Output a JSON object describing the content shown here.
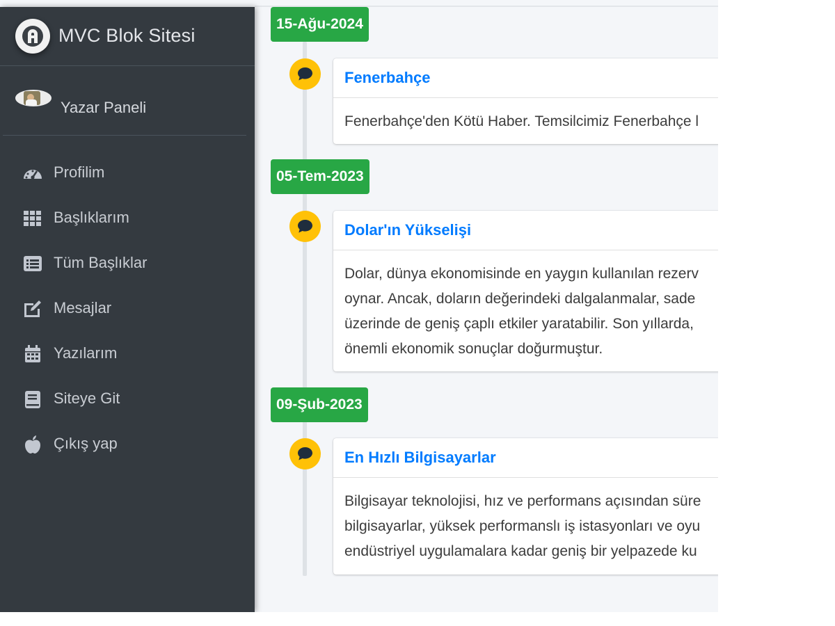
{
  "sidebar": {
    "brand": "MVC Blok Sitesi",
    "user": "Yazar Paneli",
    "items": [
      {
        "label": "Profilim",
        "icon": "tachometer-icon"
      },
      {
        "label": "Başlıklarım",
        "icon": "grid-icon"
      },
      {
        "label": "Tüm Başlıklar",
        "icon": "list-icon"
      },
      {
        "label": "Mesajlar",
        "icon": "edit-icon"
      },
      {
        "label": "Yazılarım",
        "icon": "calendar-icon"
      },
      {
        "label": "Siteye Git",
        "icon": "book-icon"
      },
      {
        "label": "Çıkış yap",
        "icon": "apple-icon"
      }
    ]
  },
  "timeline": [
    {
      "date": "15-Ağu-2024",
      "title": "Fenerbahçe",
      "lines": [
        "Fenerbahçe'den Kötü Haber. Temsilcimiz Fenerbahçe l"
      ]
    },
    {
      "date": "05-Tem-2023",
      "title": "Dolar'ın Yükselişi",
      "lines": [
        "Dolar, dünya ekonomisinde en yaygın kullanılan rezerv",
        "oynar. Ancak, doların değerindeki dalgalanmalar, sade",
        "üzerinde de geniş çaplı etkiler yaratabilir. Son yıllarda,",
        "önemli ekonomik sonuçlar doğurmuştur."
      ]
    },
    {
      "date": "09-Şub-2023",
      "title": "En Hızlı Bilgisayarlar",
      "lines": [
        "Bilgisayar teknolojisi, hız ve performans açısından süre",
        "bilgisayarlar, yüksek performanslı iş istasyonları ve oyu",
        "endüstriyel uygulamalara kadar geniş bir yelpazede ku"
      ]
    }
  ],
  "colors": {
    "sidebar": "#343a40",
    "date_badge": "#28a745",
    "comment_icon": "#ffc107",
    "title_link": "#007bff"
  }
}
